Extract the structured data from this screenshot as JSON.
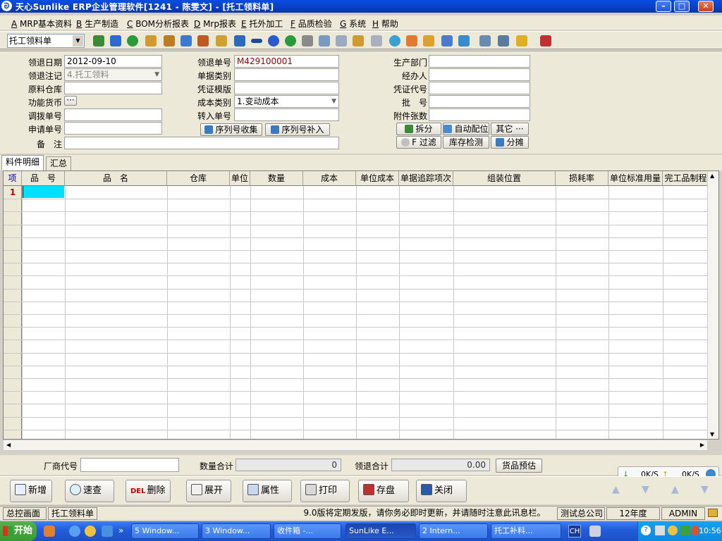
{
  "window": {
    "title": "天心Sunlike ERP企业管理软件[1241 - 陈雯文] - [托工领料单]"
  },
  "menu": {
    "items": [
      {
        "key": "A",
        "label": "MRP基本资料"
      },
      {
        "key": "B",
        "label": "生产制造"
      },
      {
        "key": "C",
        "label": "BOM分析报表"
      },
      {
        "key": "D",
        "label": "Mrp报表"
      },
      {
        "key": "E",
        "label": "托外加工"
      },
      {
        "key": "F",
        "label": "品质检验"
      },
      {
        "key": "G",
        "label": "系统"
      },
      {
        "key": "H",
        "label": "帮助"
      }
    ]
  },
  "toolbar": {
    "form_select": "托工领料单"
  },
  "form": {
    "date_label": "领退日期",
    "date_value": "2012-09-10",
    "mark_label": "领退注记",
    "mark_value": "4.托工领料",
    "warehouse_label": "原料仓库",
    "warehouse_value": "",
    "currency_label": "功能货币",
    "currency_btn": "···",
    "transfer_label": "调拨单号",
    "transfer_value": "",
    "apply_label": "申请单号",
    "apply_value": "",
    "remark_label": "备　注",
    "remark_value": "",
    "docno_label": "领退单号",
    "docno_value": "M429100001",
    "doctype_label": "单据类别",
    "doctype_value": "",
    "voucher_tpl_label": "凭证模版",
    "voucher_tpl_value": "",
    "costtype_label": "成本类别",
    "costtype_value": "1.变动成本",
    "transno_label": "转入单号",
    "transno_value": "",
    "dept_label": "生产部门",
    "dept_value": "",
    "handler_label": "经办人",
    "handler_value": "",
    "voucher_code_label": "凭证代号",
    "voucher_code_value": "",
    "batch_label": "批　号",
    "batch_value": "",
    "attach_label": "附件张数",
    "attach_value": ""
  },
  "form_buttons": {
    "serial_collect": "序列号收集",
    "serial_add": "序列号补入",
    "split": "拆分",
    "auto_match": "自动配位",
    "other": "其它 ···",
    "filter": "F 过滤",
    "stock_check": "库存检测",
    "allocate": "分摊"
  },
  "tabs": [
    {
      "label": "料件明细"
    },
    {
      "label": "汇总"
    }
  ],
  "grid": {
    "columns": [
      "项",
      "品　号",
      "品　名",
      "仓库",
      "单位",
      "数量",
      "成本",
      "单位成本",
      "单据追踪项次",
      "组装位置",
      "损耗率",
      "单位标准用量",
      "完工品制程"
    ],
    "first_row_number": "1"
  },
  "footer": {
    "vendor_label": "厂商代号",
    "vendor_value": "",
    "qty_total_label": "数量合计",
    "qty_total_value": "0",
    "return_total_label": "领退合计",
    "return_total_value": "0.00",
    "estimate_btn": "货品预估"
  },
  "net": {
    "down": "0K/S",
    "up": "0K/S"
  },
  "actions": [
    {
      "label": "新增"
    },
    {
      "label": "速查"
    },
    {
      "label": "删除",
      "icon_text": "DEL"
    },
    {
      "label": "展开"
    },
    {
      "label": "属性"
    },
    {
      "label": "打印"
    },
    {
      "label": "存盘"
    },
    {
      "label": "关闭"
    }
  ],
  "status": {
    "home": "总控画面",
    "current": "托工领料单",
    "message": "9.0版将定期发版，请你务必即时更新，并请随时注意此讯息栏。",
    "company": "测试总公司",
    "year": "12年度",
    "user": "ADMIN"
  },
  "taskbar": {
    "start": "开始",
    "tasks": [
      {
        "label": "5 Window..."
      },
      {
        "label": "3 Window..."
      },
      {
        "label": "收件箱 -..."
      },
      {
        "label": "SunLike E..."
      },
      {
        "label": "2 Intern..."
      },
      {
        "label": "托工补料..."
      }
    ],
    "ime": "CH",
    "time": "10:56"
  }
}
